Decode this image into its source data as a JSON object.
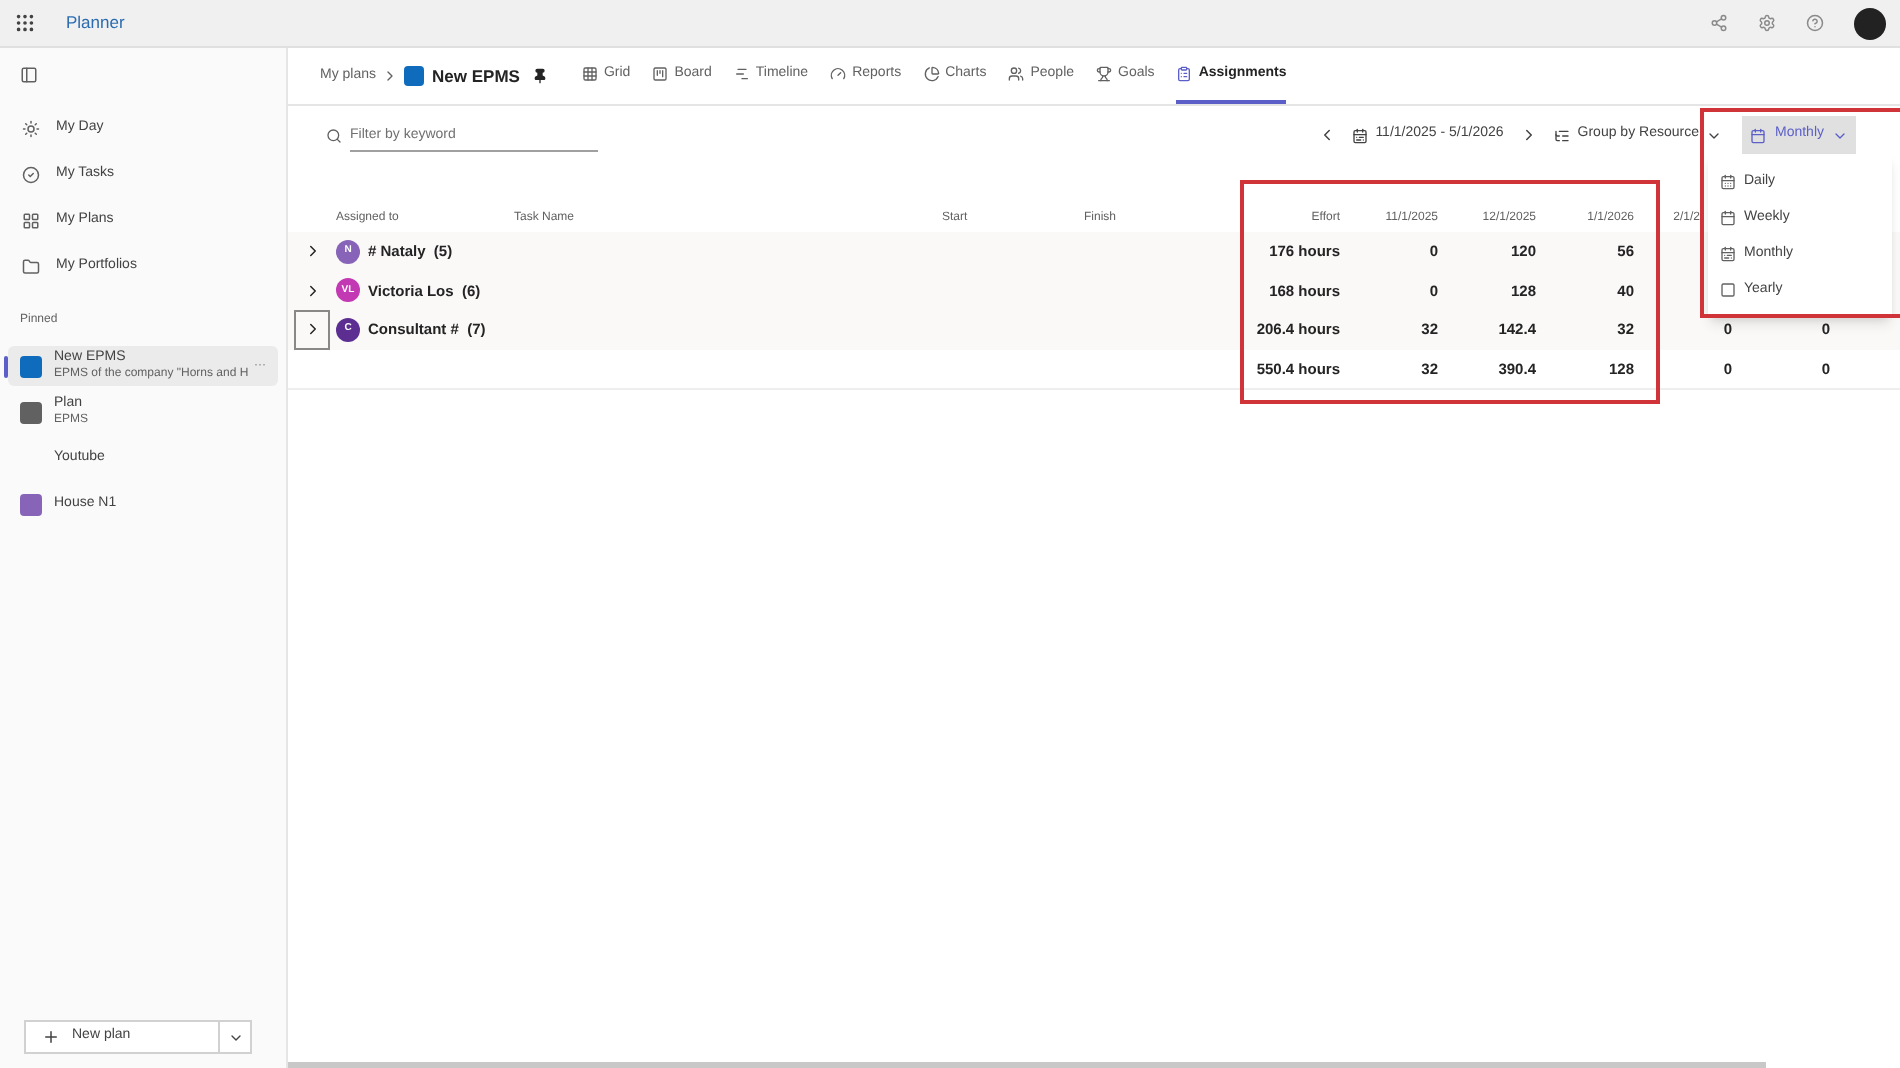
{
  "app": {
    "title": "Planner"
  },
  "sidebar": {
    "nav": [
      {
        "label": "My Day"
      },
      {
        "label": "My Tasks"
      },
      {
        "label": "My Plans"
      },
      {
        "label": "My Portfolios"
      }
    ],
    "pinned_heading": "Pinned",
    "pinned": [
      {
        "title": "New EPMS",
        "subtitle": "EPMS of the company \"Horns and H",
        "selected": true,
        "color": "#0f6cbd",
        "more": "···"
      },
      {
        "title": "Plan",
        "subtitle": "EPMS",
        "selected": false,
        "color": "#616161"
      },
      {
        "title": "Youtube",
        "selected": false
      },
      {
        "title": "House N1",
        "selected": false,
        "color": "#8764b8"
      }
    ],
    "new_plan": "New plan"
  },
  "breadcrumb": {
    "root": "My plans",
    "plan": "New EPMS"
  },
  "tabs": [
    {
      "label": "Grid",
      "selected": false
    },
    {
      "label": "Board",
      "selected": false
    },
    {
      "label": "Timeline",
      "selected": false
    },
    {
      "label": "Reports",
      "selected": false
    },
    {
      "label": "Charts",
      "selected": false
    },
    {
      "label": "People",
      "selected": false
    },
    {
      "label": "Goals",
      "selected": false
    },
    {
      "label": "Assignments",
      "selected": true
    }
  ],
  "filter": {
    "placeholder": "Filter by keyword"
  },
  "toolbar": {
    "date_range": "11/1/2025 - 5/1/2026",
    "group_by": "Group by Resource",
    "period": "Monthly"
  },
  "period_menu": {
    "open": true,
    "options": [
      "Daily",
      "Weekly",
      "Monthly",
      "Yearly"
    ]
  },
  "table": {
    "columns": [
      "Assigned to",
      "Task Name",
      "Start",
      "Finish",
      "Effort"
    ],
    "date_columns": [
      "11/1/2025",
      "12/1/2025",
      "1/1/2026",
      "2/1/2"
    ],
    "rows": [
      {
        "initials": "N",
        "color": "#8764b8",
        "name": "# Nataly  (5)",
        "expanded": false,
        "focused": false,
        "effort": "176 hours",
        "values": [
          "0",
          "120",
          "56"
        ]
      },
      {
        "initials": "VL",
        "color": "#c239b3",
        "name": "Victoria Los  (6)",
        "expanded": false,
        "focused": false,
        "effort": "168 hours",
        "values": [
          "0",
          "128",
          "40"
        ]
      },
      {
        "initials": "C",
        "color": "#5c2e91",
        "name": "Consultant #  (7)",
        "expanded": false,
        "focused": true,
        "effort": "206.4 hours",
        "values": [
          "32",
          "142.4",
          "32",
          "0",
          "0"
        ]
      }
    ],
    "total": {
      "effort": "550.4 hours",
      "values": [
        "32",
        "390.4",
        "128",
        "0",
        "0"
      ]
    }
  }
}
